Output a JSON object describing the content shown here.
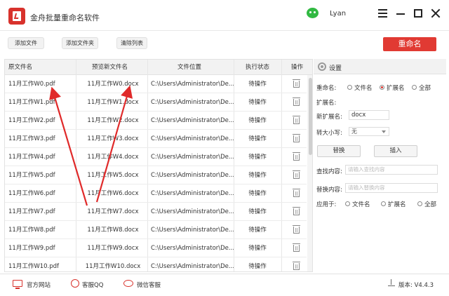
{
  "app": {
    "title": "金舟批量重命名软件",
    "user": "Lyan"
  },
  "toolbar": {
    "add_file": "添加文件",
    "add_folder": "添加文件夹",
    "clear_list": "清除列表",
    "rename": "重命名"
  },
  "table": {
    "headers": {
      "original": "原文件名",
      "preview": "预览新文件名",
      "location": "文件位置",
      "status": "执行状态",
      "action": "操作"
    },
    "rows": [
      {
        "original": "11月工作W0.pdf",
        "preview": "11月工作W0.docx",
        "location": "C:\\Users\\Administrator\\De...",
        "status": "待操作"
      },
      {
        "original": "11月工作W1.pdf",
        "preview": "11月工作W1.docx",
        "location": "C:\\Users\\Administrator\\De...",
        "status": "待操作"
      },
      {
        "original": "11月工作W2.pdf",
        "preview": "11月工作W2.docx",
        "location": "C:\\Users\\Administrator\\De...",
        "status": "待操作"
      },
      {
        "original": "11月工作W3.pdf",
        "preview": "11月工作W3.docx",
        "location": "C:\\Users\\Administrator\\De...",
        "status": "待操作"
      },
      {
        "original": "11月工作W4.pdf",
        "preview": "11月工作W4.docx",
        "location": "C:\\Users\\Administrator\\De...",
        "status": "待操作"
      },
      {
        "original": "11月工作W5.pdf",
        "preview": "11月工作W5.docx",
        "location": "C:\\Users\\Administrator\\De...",
        "status": "待操作"
      },
      {
        "original": "11月工作W6.pdf",
        "preview": "11月工作W6.docx",
        "location": "C:\\Users\\Administrator\\De...",
        "status": "待操作"
      },
      {
        "original": "11月工作W7.pdf",
        "preview": "11月工作W7.docx",
        "location": "C:\\Users\\Administrator\\De...",
        "status": "待操作"
      },
      {
        "original": "11月工作W8.pdf",
        "preview": "11月工作W8.docx",
        "location": "C:\\Users\\Administrator\\De...",
        "status": "待操作"
      },
      {
        "original": "11月工作W9.pdf",
        "preview": "11月工作W9.docx",
        "location": "C:\\Users\\Administrator\\De...",
        "status": "待操作"
      },
      {
        "original": "11月工作W10.pdf",
        "preview": "11月工作W10.docx",
        "location": "C:\\Users\\Administrator\\De...",
        "status": "待操作"
      }
    ]
  },
  "settings": {
    "title": "设置",
    "rename_label": "重命名:",
    "rename_options": [
      "文件名",
      "扩展名",
      "全部"
    ],
    "rename_selected": "扩展名",
    "ext_label": "扩展名:",
    "new_ext_label": "新扩展名:",
    "new_ext_value": "docx",
    "case_label": "转大小写:",
    "case_value": "无",
    "replace_button": "替换",
    "insert_button": "插入",
    "find_label": "查找内容:",
    "find_placeholder": "请输入查找内容",
    "replace_label": "替换内容:",
    "replace_placeholder": "请输入替换内容",
    "apply_label": "应用于:",
    "apply_options": [
      "文件名",
      "扩展名",
      "全部"
    ]
  },
  "footer": {
    "website": "官方网站",
    "qq": "客服QQ",
    "wechat": "微信客服",
    "version": "版本: V4.4.3"
  },
  "colors": {
    "accent": "#e13a33",
    "wechat": "#31b942"
  }
}
